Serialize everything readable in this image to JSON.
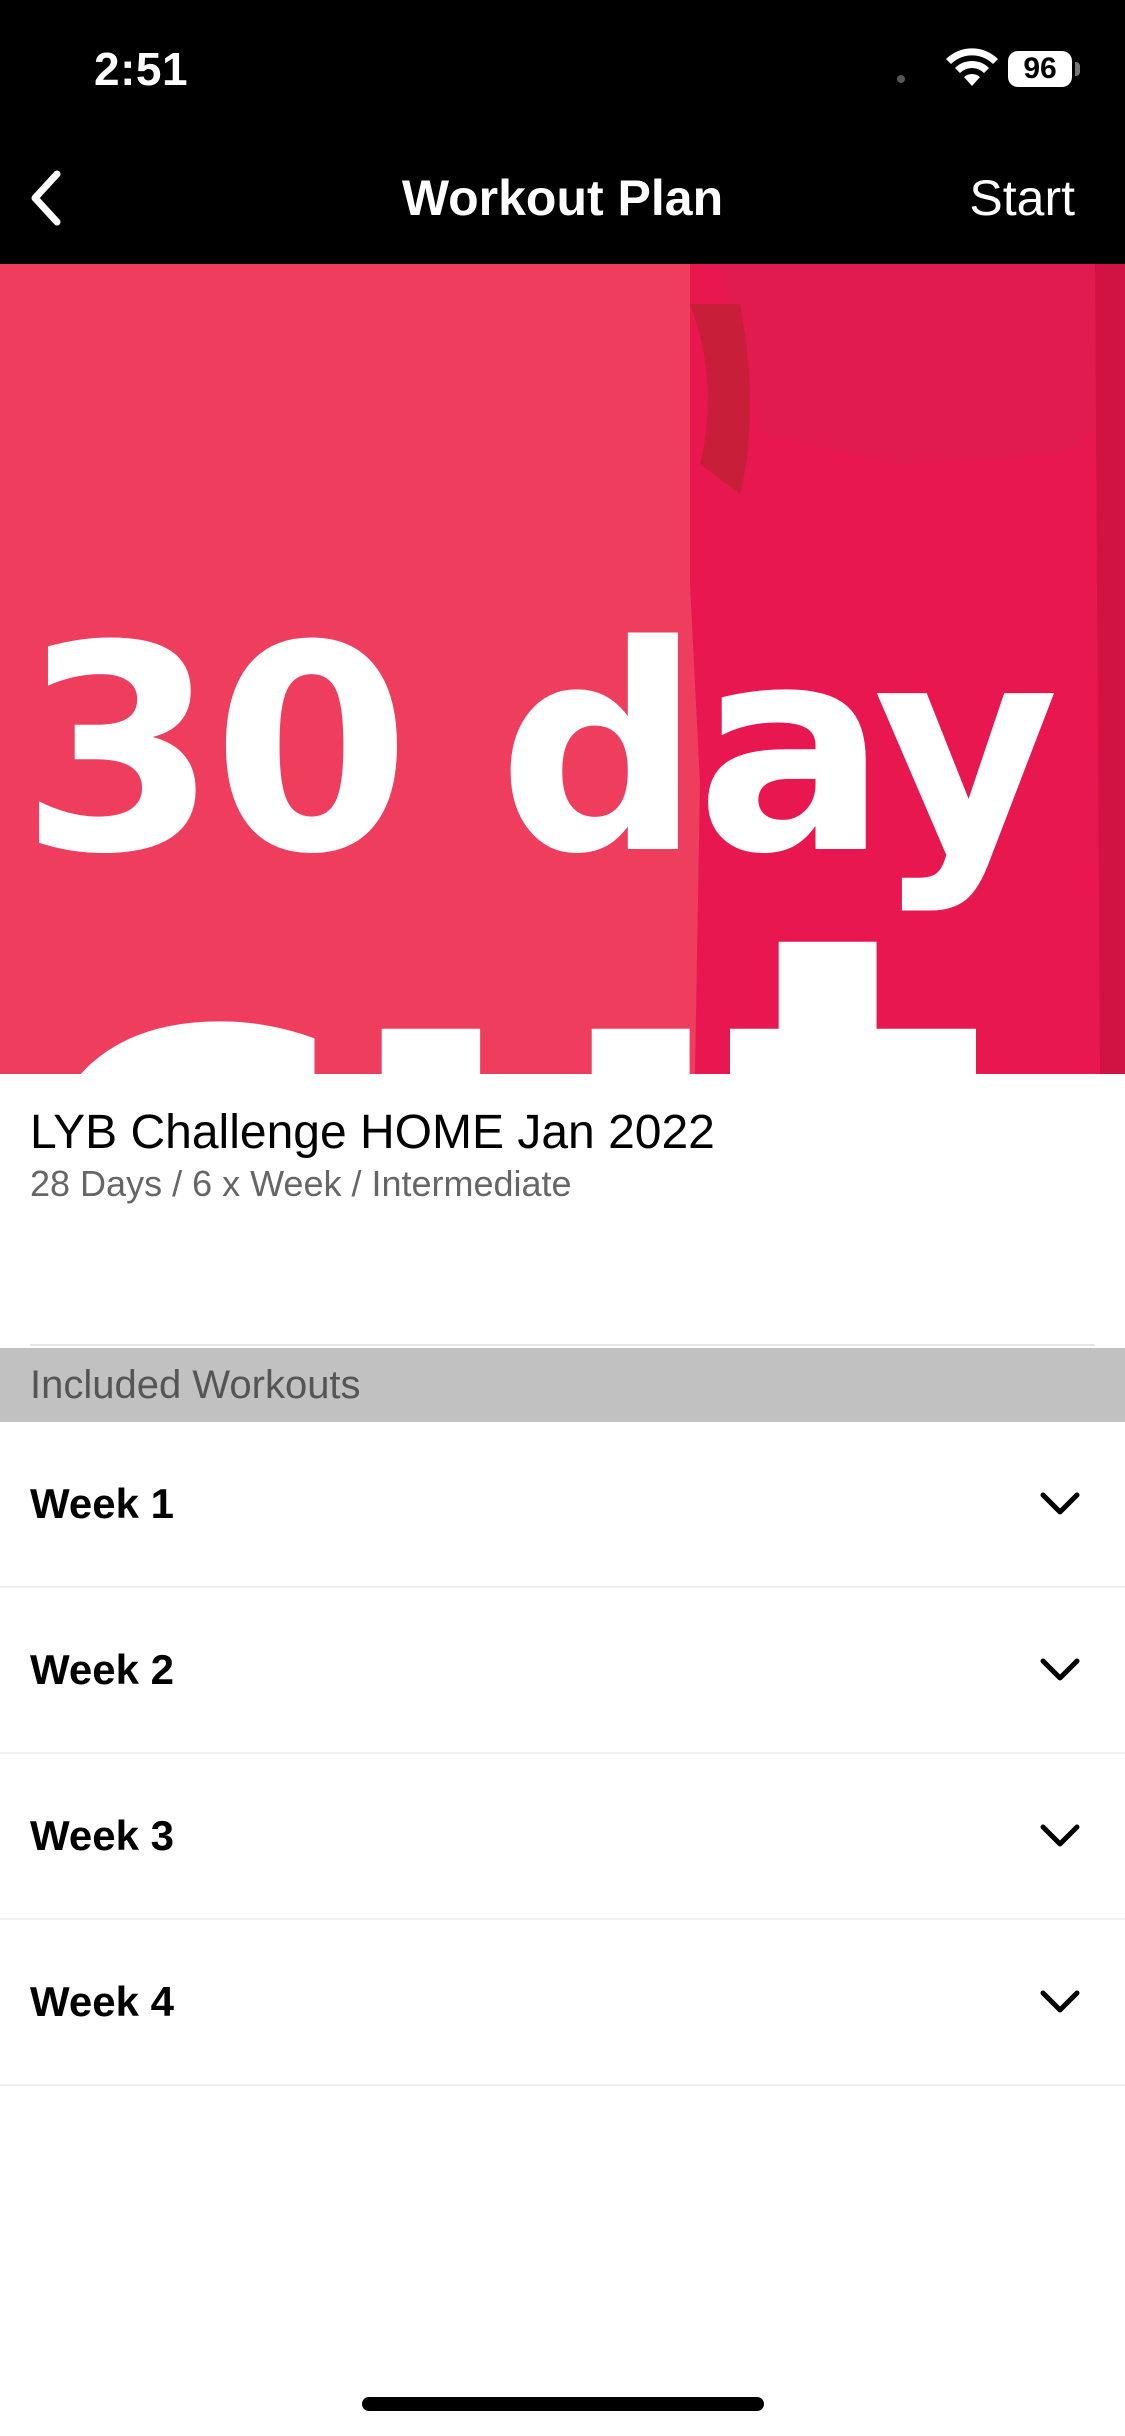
{
  "status_bar": {
    "time": "2:51",
    "battery_level": "96",
    "icons": [
      "wifi-icon",
      "battery-icon"
    ]
  },
  "nav": {
    "back_icon": "chevron-left-icon",
    "title": "Workout Plan",
    "start_label": "Start"
  },
  "hero": {
    "line1": "30 day",
    "line2": "cut",
    "background_color": "#ef3c5c"
  },
  "plan": {
    "title": "LYB Challenge HOME Jan 2022",
    "meta": "28 Days / 6 x Week / Intermediate"
  },
  "included": {
    "header": "Included Workouts",
    "weeks": [
      {
        "label": "Week 1",
        "icon": "chevron-down-icon"
      },
      {
        "label": "Week 2",
        "icon": "chevron-down-icon"
      },
      {
        "label": "Week 3",
        "icon": "chevron-down-icon"
      },
      {
        "label": "Week 4",
        "icon": "chevron-down-icon"
      }
    ]
  }
}
